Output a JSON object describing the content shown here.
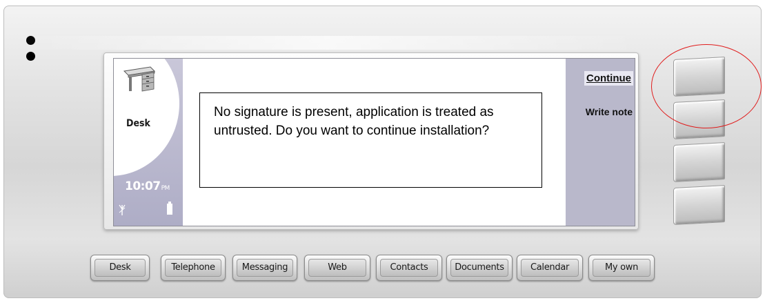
{
  "left_pane": {
    "app_icon": "desk-icon",
    "app_label": "Desk",
    "clock_time": "10:07",
    "clock_ampm": "PM",
    "signal_icon": "signal-antenna-icon",
    "battery_icon": "battery-icon"
  },
  "dialog": {
    "message": "No signature is present, application is treated as untrusted. Do you want to continue installation?"
  },
  "softkeys": {
    "continue": "Continue",
    "write_note": "Write note"
  },
  "app_buttons": [
    "Desk",
    "Telephone",
    "Messaging",
    "Web",
    "Contacts",
    "Documents",
    "Calendar",
    "My own"
  ],
  "colors": {
    "highlight_ring": "#e01b1b",
    "pane_lavender": "#b9b8cb"
  }
}
